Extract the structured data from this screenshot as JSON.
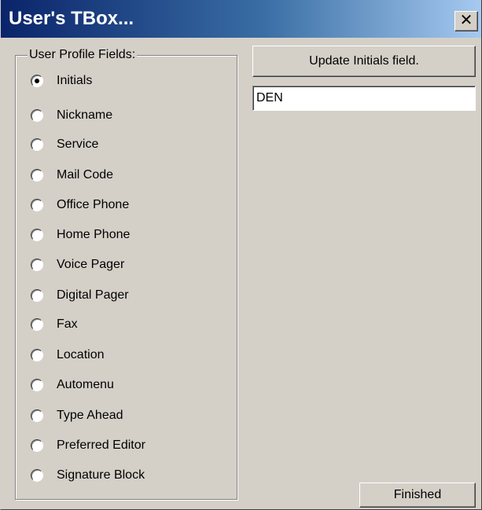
{
  "window": {
    "title": "User's TBox...",
    "close_glyph": "✕"
  },
  "profile_fields": {
    "group_label": "User Profile Fields:",
    "selected_index": 0,
    "items": [
      {
        "label": "Initials",
        "checked": true
      },
      {
        "label": "Nickname",
        "checked": false
      },
      {
        "label": "Service",
        "checked": false
      },
      {
        "label": "Mail Code",
        "checked": false
      },
      {
        "label": "Office Phone",
        "checked": false
      },
      {
        "label": "Home Phone",
        "checked": false
      },
      {
        "label": "Voice Pager",
        "checked": false
      },
      {
        "label": "Digital Pager",
        "checked": false
      },
      {
        "label": "Fax",
        "checked": false
      },
      {
        "label": "Location",
        "checked": false
      },
      {
        "label": "Automenu",
        "checked": false
      },
      {
        "label": "Type Ahead",
        "checked": false
      },
      {
        "label": "Preferred Editor",
        "checked": false
      },
      {
        "label": "Signature Block",
        "checked": false
      }
    ]
  },
  "update": {
    "button_label": "Update Initials field.",
    "field_value": "DEN"
  },
  "footer": {
    "finished_label": "Finished"
  },
  "colors": {
    "face": "#d4d0c8",
    "title_start": "#0a246a",
    "title_end": "#a6caf0"
  }
}
